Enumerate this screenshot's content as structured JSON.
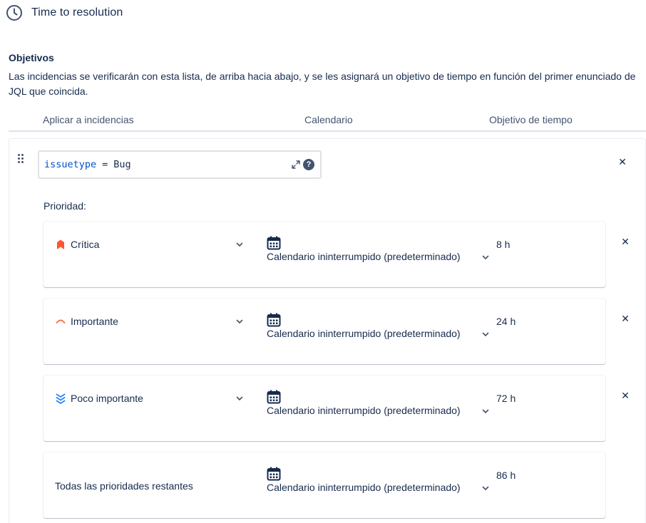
{
  "header": {
    "title": "Time to resolution",
    "icon": "clock-icon"
  },
  "goals_section": {
    "heading": "Objetivos",
    "description": "Las incidencias se verificarán con esta lista, de arriba hacia abajo, y se les asignará un objetivo de tiempo en función del primer enunciado de JQL que coincida."
  },
  "columns": {
    "apply_to": "Aplicar a incidencias",
    "calendar": "Calendario",
    "time_goal": "Objetivo de tiempo"
  },
  "goal": {
    "jql": {
      "field": "issuetype",
      "operator": "=",
      "value": "Bug"
    },
    "help_label": "?",
    "priority_label": "Prioridad:",
    "rows": [
      {
        "priority": "Crítica",
        "icon": "priority-critical-icon",
        "calendar": "Calendario ininterrumpido (predeterminado)",
        "time": "8 h"
      },
      {
        "priority": "Importante",
        "icon": "priority-high-icon",
        "calendar": "Calendario ininterrumpido (predeterminado)",
        "time": "24 h"
      },
      {
        "priority": "Poco importante",
        "icon": "priority-lowest-icon",
        "calendar": "Calendario ininterrumpido (predeterminado)",
        "time": "72 h"
      },
      {
        "priority": "Todas las prioridades restantes",
        "calendar": "Calendario ininterrumpido (predeterminado)",
        "time": "86 h"
      }
    ]
  },
  "colors": {
    "text": "#172b4d",
    "link_blue": "#0052cc",
    "critical": "#ff5630",
    "high": "#ff7452",
    "low": "#2684ff"
  },
  "close_glyph": "✕"
}
